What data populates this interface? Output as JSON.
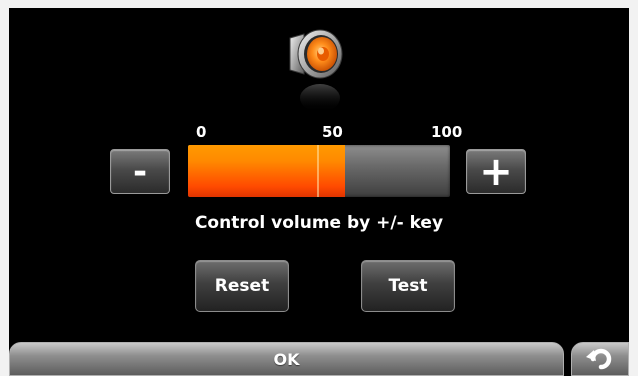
{
  "volume": {
    "icon": "speaker-icon",
    "scale_labels": {
      "min": "0",
      "mid": "50",
      "max": "100"
    },
    "level_percent": 60,
    "minus_label": "-",
    "plus_label": "+",
    "hint": "Control volume by +/- key"
  },
  "actions": {
    "reset_label": "Reset",
    "test_label": "Test"
  },
  "footer": {
    "ok_label": "OK",
    "back_icon": "back-arrow-icon"
  },
  "colors": {
    "background": "#000000",
    "fill": "#ff6a00",
    "track": "#6a6a6a"
  }
}
